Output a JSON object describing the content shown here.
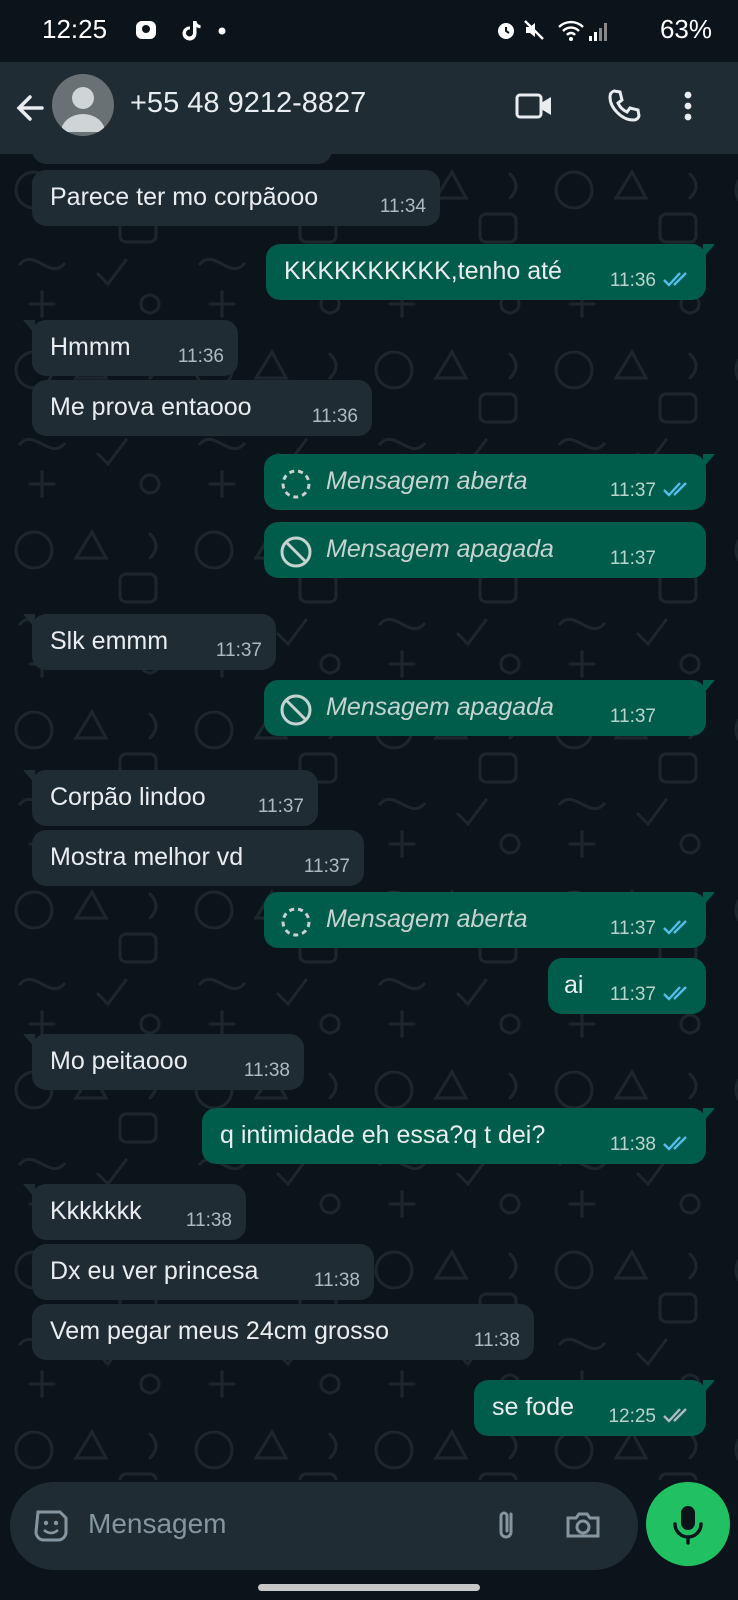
{
  "status_bar": {
    "time": "12:25",
    "battery": "63%"
  },
  "header": {
    "contact": "+55 48 9212-8827"
  },
  "messages": [
    {
      "dir": "in",
      "text": "Parece ter mo corpãooo",
      "time": "11:34"
    },
    {
      "dir": "out",
      "text": "KKKKKKKKKK,tenho até",
      "time": "11:36"
    },
    {
      "dir": "in",
      "text": "Hmmm",
      "time": "11:36"
    },
    {
      "dir": "in",
      "text": "Me prova entaooo",
      "time": "11:36"
    },
    {
      "dir": "out",
      "text": "Mensagem aberta",
      "time": "11:37"
    },
    {
      "dir": "out",
      "text": "Mensagem apagada",
      "time": "11:37"
    },
    {
      "dir": "in",
      "text": "Slk emmm",
      "time": "11:37"
    },
    {
      "dir": "out",
      "text": "Mensagem apagada",
      "time": "11:37"
    },
    {
      "dir": "in",
      "text": "Corpão lindoo",
      "time": "11:37"
    },
    {
      "dir": "in",
      "text": "Mostra melhor vd",
      "time": "11:37"
    },
    {
      "dir": "out",
      "text": "Mensagem aberta",
      "time": "11:37"
    },
    {
      "dir": "out",
      "text": "ai",
      "time": "11:37"
    },
    {
      "dir": "in",
      "text": "Mo peitaooo",
      "time": "11:38"
    },
    {
      "dir": "out",
      "text": "q intimidade eh essa?q t dei?",
      "time": "11:38"
    },
    {
      "dir": "in",
      "text": "Kkkkkkk",
      "time": "11:38"
    },
    {
      "dir": "in",
      "text": "Dx eu ver princesa",
      "time": "11:38"
    },
    {
      "dir": "in",
      "text": "Vem pegar meus 24cm grosso",
      "time": "11:38"
    },
    {
      "dir": "out",
      "text": "se fode",
      "time": "12:25"
    }
  ],
  "input": {
    "placeholder": "Mensagem"
  },
  "colors": {
    "incoming": "#202c33",
    "outgoing": "#005c4b",
    "read_ticks": "#53bdeb",
    "mic": "#21c063"
  }
}
